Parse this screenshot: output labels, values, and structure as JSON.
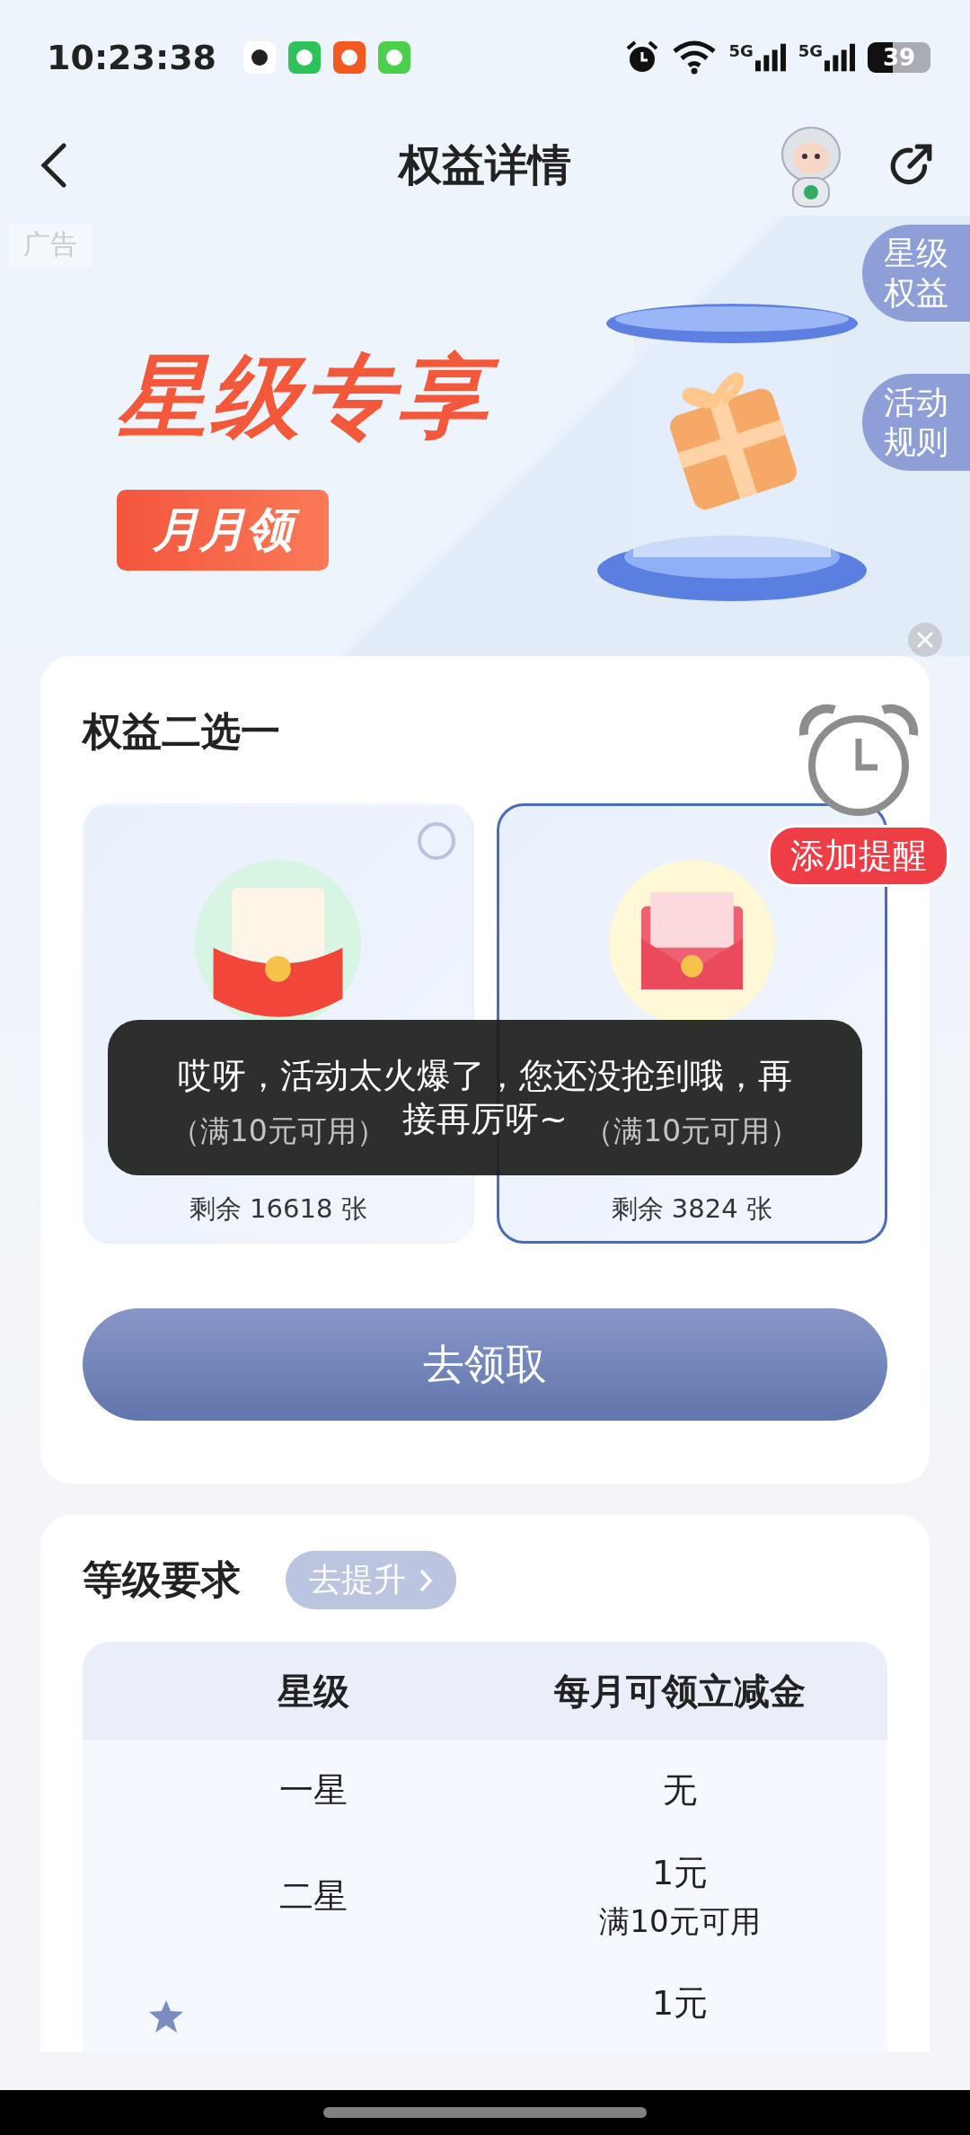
{
  "status_bar": {
    "time": "10:23:38",
    "network_labels": [
      "5G",
      "5G"
    ],
    "battery": "39"
  },
  "nav": {
    "title": "权益详情"
  },
  "banner": {
    "ad_tag": "广告",
    "headline": "星级专享",
    "subline": "月月领"
  },
  "side_tabs": [
    {
      "label": "星级权益"
    },
    {
      "label": "活动规则"
    }
  ],
  "benefit_card": {
    "title": "权益二选一",
    "options": [
      {
        "kind": "pocket",
        "condition": "（满10元可用）",
        "remaining": "剩余 16618 张",
        "selected": false
      },
      {
        "kind": "envelope",
        "condition": "（满10元可用）",
        "remaining": "剩余 3824 张",
        "selected": true
      }
    ],
    "reminder": "添加提醒",
    "claim_button": "去领取"
  },
  "toast": "哎呀，活动太火爆了，您还没抢到哦，再接再厉呀~",
  "level_card": {
    "title": "等级要求",
    "upgrade_link": "去提升",
    "columns": [
      "星级",
      "每月可领立减金"
    ],
    "rows": [
      {
        "level": "一星",
        "amount": "无",
        "current": false
      },
      {
        "level": "二星",
        "amount": "1元",
        "note": "满10元可用",
        "current": false
      },
      {
        "amount": "1元",
        "current": true
      }
    ]
  }
}
